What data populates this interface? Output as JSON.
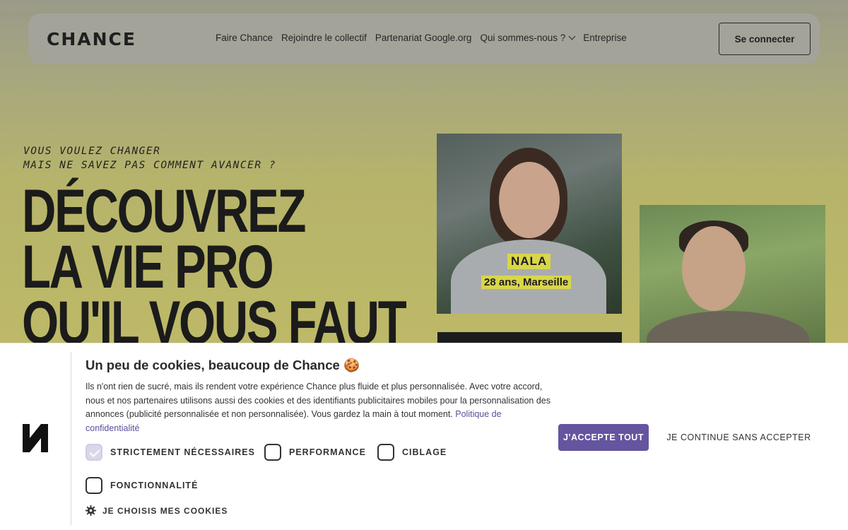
{
  "header": {
    "logo": "CHANCE",
    "nav": [
      {
        "label": "Faire Chance"
      },
      {
        "label": "Rejoindre le collectif"
      },
      {
        "label": "Partenariat Google.org"
      },
      {
        "label": "Qui sommes-nous ?"
      },
      {
        "label": "Entreprise"
      }
    ],
    "login_label": "Se connecter"
  },
  "hero": {
    "tagline_line1": "VOUS VOULEZ CHANGER",
    "tagline_line2": "MAIS NE SAVEZ PAS COMMENT AVANCER ?",
    "headline_line1": "DÉCOUVREZ",
    "headline_line2": "LA VIE PRO",
    "headline_line3": "QU'IL VOUS FAUT",
    "profile": {
      "name": "NALA",
      "details": "28 ans, Marseille"
    }
  },
  "cookie_banner": {
    "title": "Un peu de cookies, beaucoup de Chance 🍪",
    "text": "Ils n'ont rien de sucré, mais ils rendent votre expérience Chance plus fluide et plus personnalisée. Avec votre accord, nous et nos partenaires utilisons aussi des cookies et des identifiants publicitaires mobiles pour la personnalisation des annonces (publicité personnalisée et non personnalisée). Vous gardez la main à tout moment.",
    "policy_link": "Politique de confidentialité",
    "options": [
      {
        "label": "STRICTEMENT NÉCESSAIRES",
        "checked": true
      },
      {
        "label": "PERFORMANCE",
        "checked": false
      },
      {
        "label": "CIBLAGE",
        "checked": false
      },
      {
        "label": "FONCTIONNALITÉ",
        "checked": false
      }
    ],
    "choose_label": "JE CHOISIS MES COOKIES",
    "accept_label": "J'ACCEPTE TOUT",
    "decline_label": "JE CONTINUE SANS ACCEPTER"
  },
  "colors": {
    "accent": "#65549f",
    "hero_yellow": "#d9d64a"
  },
  "icons": [
    "chevron-down-icon",
    "gear-icon",
    "check-icon",
    "chance-logo-icon"
  ]
}
